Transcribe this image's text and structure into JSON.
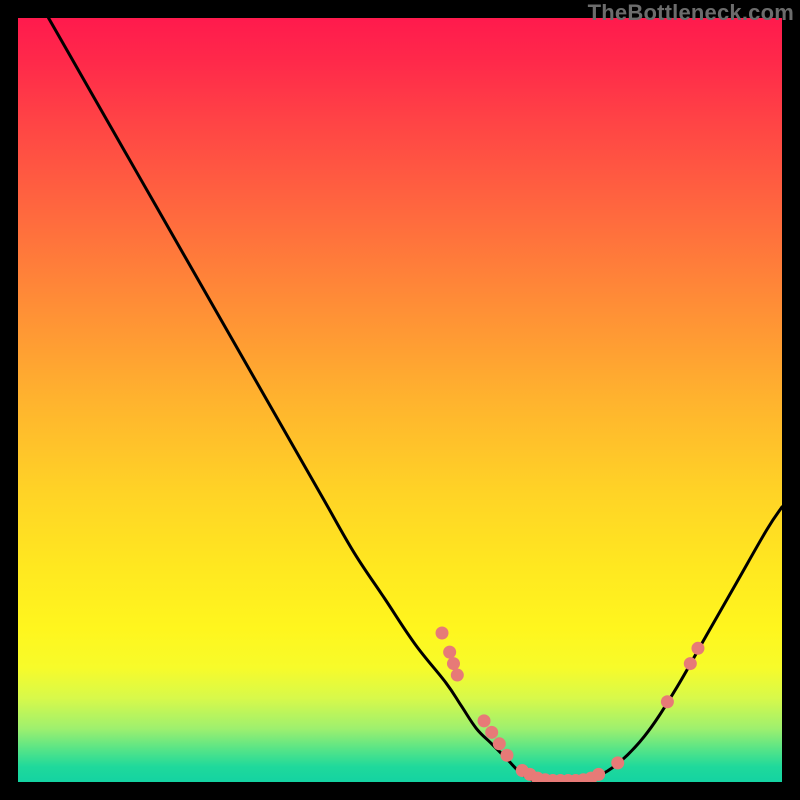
{
  "watermark": "TheBottleneck.com",
  "chart_data": {
    "type": "line",
    "title": "",
    "xlabel": "",
    "ylabel": "",
    "xlim": [
      0,
      100
    ],
    "ylim": [
      0,
      100
    ],
    "grid": false,
    "legend": false,
    "series": [
      {
        "name": "bottleneck-curve",
        "x": [
          4,
          8,
          12,
          16,
          20,
          24,
          28,
          32,
          36,
          40,
          44,
          48,
          52,
          56,
          58,
          60,
          62,
          64,
          66,
          68,
          70,
          72,
          74,
          78,
          82,
          86,
          90,
          94,
          98,
          100
        ],
        "y": [
          100,
          93,
          86,
          79,
          72,
          65,
          58,
          51,
          44,
          37,
          30,
          24,
          18,
          13,
          10,
          7,
          5,
          3,
          1,
          0,
          0,
          0,
          0,
          2,
          6,
          12,
          19,
          26,
          33,
          36
        ]
      }
    ],
    "highlight_points": {
      "name": "marker-dots",
      "color": "#e77a77",
      "points": [
        {
          "x": 55.5,
          "y": 19.5
        },
        {
          "x": 56.5,
          "y": 17.0
        },
        {
          "x": 57.0,
          "y": 15.5
        },
        {
          "x": 57.5,
          "y": 14.0
        },
        {
          "x": 61.0,
          "y": 8.0
        },
        {
          "x": 62.0,
          "y": 6.5
        },
        {
          "x": 63.0,
          "y": 5.0
        },
        {
          "x": 64.0,
          "y": 3.5
        },
        {
          "x": 66.0,
          "y": 1.5
        },
        {
          "x": 67.0,
          "y": 1.0
        },
        {
          "x": 68.0,
          "y": 0.5
        },
        {
          "x": 69.0,
          "y": 0.3
        },
        {
          "x": 70.0,
          "y": 0.2
        },
        {
          "x": 71.0,
          "y": 0.2
        },
        {
          "x": 72.0,
          "y": 0.2
        },
        {
          "x": 73.0,
          "y": 0.2
        },
        {
          "x": 74.0,
          "y": 0.3
        },
        {
          "x": 75.0,
          "y": 0.5
        },
        {
          "x": 76.0,
          "y": 1.0
        },
        {
          "x": 78.5,
          "y": 2.5
        },
        {
          "x": 85.0,
          "y": 10.5
        },
        {
          "x": 88.0,
          "y": 15.5
        },
        {
          "x": 89.0,
          "y": 17.5
        }
      ]
    }
  }
}
